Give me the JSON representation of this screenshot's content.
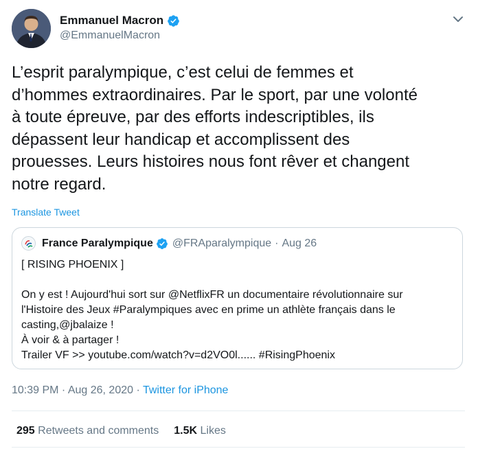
{
  "author": {
    "name": "Emmanuel Macron",
    "handle": "@EmmanuelMacron",
    "avatar_icon": "user-avatar"
  },
  "tweet": {
    "text_lines": [
      "L’esprit paralympique, c’est celui de femmes et",
      "d’hommes extraordinaires. Par le sport, par une volonté",
      "à toute épreuve, par des efforts indescriptibles, ils",
      "dépassent leur handicap et accomplissent des",
      "prouesses. Leurs histoires nous font rêver et changent",
      "notre regard."
    ],
    "translate_label": "Translate Tweet"
  },
  "quoted": {
    "name": "France Paralympique",
    "handle": "@FRAparalympique",
    "separator": "·",
    "date": "Aug 26",
    "lines": [
      "[ RISING PHOENIX ]",
      "",
      "On y est ! Aujourd'hui sort sur @NetflixFR un documentaire révolutionnaire sur",
      "l'Histoire des Jeux #Paralympiques avec en prime un athlète français dans le",
      "casting,@jbalaize !",
      "À voir & à partager !",
      "Trailer VF >> youtube.com/watch?v=d2VO0l...... #RisingPhoenix"
    ]
  },
  "meta": {
    "time_date": "10:39 PM · Aug 26, 2020 · ",
    "source": "Twitter for iPhone"
  },
  "stats": {
    "retweets_count": "295",
    "retweets_label": "Retweets and comments",
    "likes_count": "1.5K",
    "likes_label": "Likes"
  },
  "colors": {
    "accent": "#1b95e0",
    "verified": "#1da1f2",
    "secondary_text": "#657786",
    "border": "#ccd6dd"
  }
}
